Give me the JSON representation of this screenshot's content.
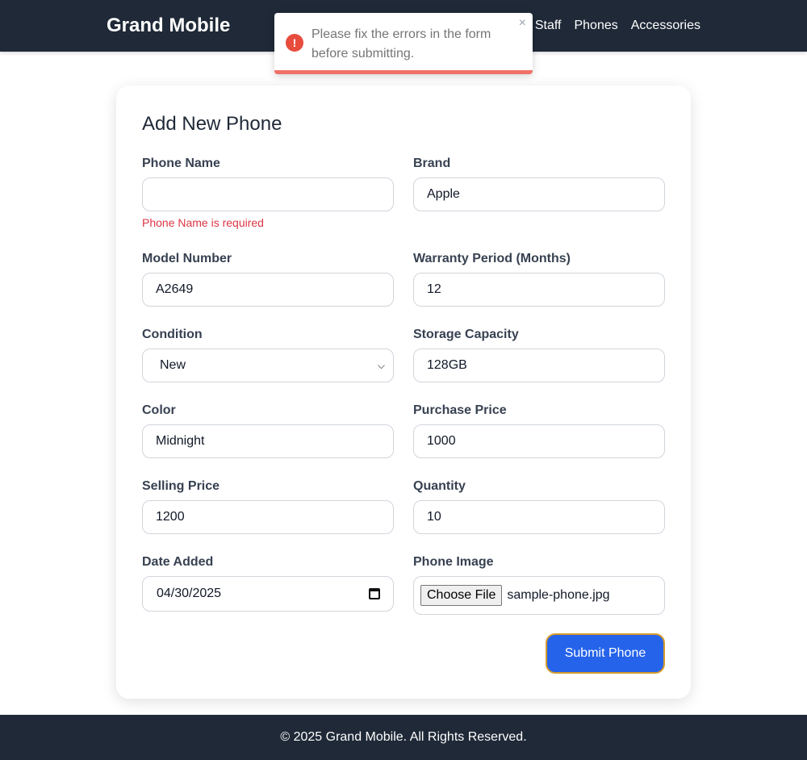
{
  "header": {
    "brand": "Grand Mobile",
    "nav": [
      "Staff",
      "Phones",
      "Accessories"
    ]
  },
  "toast": {
    "message": "Please fix the errors in the form before submitting.",
    "icon": "error-icon",
    "close_glyph": "×",
    "progress": 1.0,
    "color": "#e74c3c"
  },
  "form": {
    "title": "Add New Phone",
    "fields": {
      "phone_name": {
        "label": "Phone Name",
        "value": "",
        "error": "Phone Name is required"
      },
      "brand": {
        "label": "Brand",
        "value": "Apple"
      },
      "model_number": {
        "label": "Model Number",
        "value": "A2649"
      },
      "warranty": {
        "label": "Warranty Period (Months)",
        "value": "12"
      },
      "condition": {
        "label": "Condition",
        "value": "New"
      },
      "storage": {
        "label": "Storage Capacity",
        "value": "128GB"
      },
      "color": {
        "label": "Color",
        "value": "Midnight"
      },
      "purchase_price": {
        "label": "Purchase Price",
        "value": "1000"
      },
      "selling_price": {
        "label": "Selling Price",
        "value": "1200"
      },
      "quantity": {
        "label": "Quantity",
        "value": "10"
      },
      "date_added": {
        "label": "Date Added",
        "value": "04/30/2025"
      },
      "phone_image": {
        "label": "Phone Image",
        "button": "Choose File",
        "filename": "sample-phone.jpg"
      }
    },
    "submit_label": "Submit Phone",
    "accent_color": "#2563eb"
  },
  "footer": {
    "text": "© 2025 Grand Mobile. All Rights Reserved."
  }
}
